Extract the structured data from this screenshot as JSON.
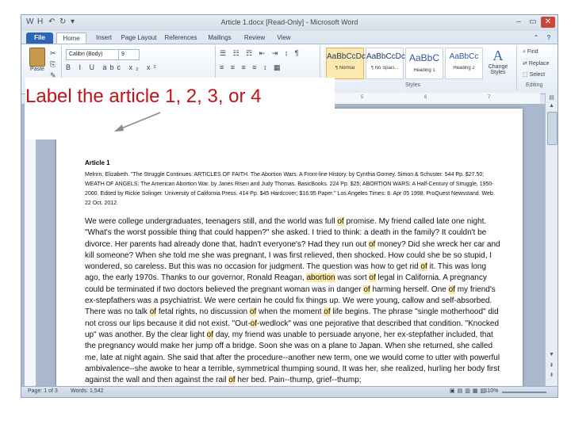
{
  "window": {
    "title": "Article 1.docx [Read-Only] - Microsoft Word",
    "quick_access": [
      "W",
      "H",
      "↶",
      "↻",
      "▾"
    ],
    "controls": [
      "–",
      "▭",
      "✕"
    ]
  },
  "ribbon_tabs": [
    "File",
    "Home",
    "Insert",
    "Page Layout",
    "References",
    "Mailings",
    "Review",
    "View"
  ],
  "ribbon": {
    "paste_label": "Paste",
    "font_name": "Calibri (Body)",
    "font_size": "9",
    "format_buttons": "B I U abc x₂ x²",
    "para_row1": "☰ ☷ ☶ ⇤ ⇥ ↕ ¶",
    "para_row2": "≡ ≡ ≡ ≡ ↕ ▦",
    "styles": [
      {
        "sample": "AaBbCcDc",
        "name": "¶ Normal"
      },
      {
        "sample": "AaBbCcDc",
        "name": "¶ No Spaci..."
      },
      {
        "sample": "AaBbC",
        "name": "Heading 1"
      },
      {
        "sample": "AaBbCc",
        "name": "Heading 2"
      }
    ],
    "change_styles": "Change Styles",
    "group_styles": "Styles",
    "group_editing": "Editing",
    "find": "Find",
    "replace": "Replace",
    "select": "Select"
  },
  "ruler_marks": [
    "5",
    "6",
    "7"
  ],
  "document": {
    "heading": "Article 1",
    "citation": "Melnrn, Elizabeth. \"The Struggle Continues. ARTICLES OF FAITH. The Abortion Wars. A Front-line History. by Cynthia Gorney. Simon & Schuster. 544 Pp. $27.50; WEATH OF ANGELS: The American Abortion War. by Janes Risen and Judy Thomas. BasicBooks. 224 Pp. $25; ABORTION WARS: A Half-Century of Struggle, 1950-2000. Edited by Rickie Solinger. University of California Press. 414 Pp. $45 Hardcover; $16.95 Paper.\" Los Angeles Times: 8. Apr 05 1998. ProQuest Newsstand. Web. 22 Oct. 2012.",
    "paragraph": "We were college undergraduates, teenagers still, and the world was full of promise. My friend called late one night. \"What's the worst possible thing that could happen?\" she asked. I tried to think: a death in the family? It couldn't be divorce. Her parents had already done that, hadn't everyone's? Had they run out of money? Did she wreck her car and kill someone? When she told me she was pregnant, I was first relieved, then shocked. How could she be so stupid, I wondered, so careless. But this was no occasion for judgment. The question was how to get rid of it. This was long ago, the early 1970s. Thanks to our governor, Ronald Reagan, abortion was sort of legal in California. A pregnancy could be terminated if two doctors believed the pregnant woman was in danger of harming herself. One of my friend's ex-stepfathers was a psychiatrist. We were certain he could fix things up. We were young, callow and self-absorbed. There was no talk of fetal rights, no discussion of when the moment of life begins. The phrase \"single motherhood\" did not cross our lips because it did not exist. \"Out-of-wedlock\" was one pejorative that described that condition. \"Knocked up\" was another. By the clear light of day, my friend was unable to persuade anyone, her ex-stepfather included, that the pregnancy would make her jump off a bridge. Soon she was on a plane to Japan. When she returned, she called me, late at night again. She said that after the procedure--another new term, one we would come to utter with powerful ambivalence--she awoke to hear a terrible, symmetrical thumping sound. It was her, she realized, hurling her body first against the wall and then against the rail of her bed. Pain--thump, grief--thump;"
  },
  "status": {
    "page": "Page: 1 of 3",
    "words": "Words: 1,542",
    "zoom": "110%"
  },
  "annotation": {
    "text": "Label the article 1, 2, 3, or 4",
    "color": "#c0121b"
  }
}
